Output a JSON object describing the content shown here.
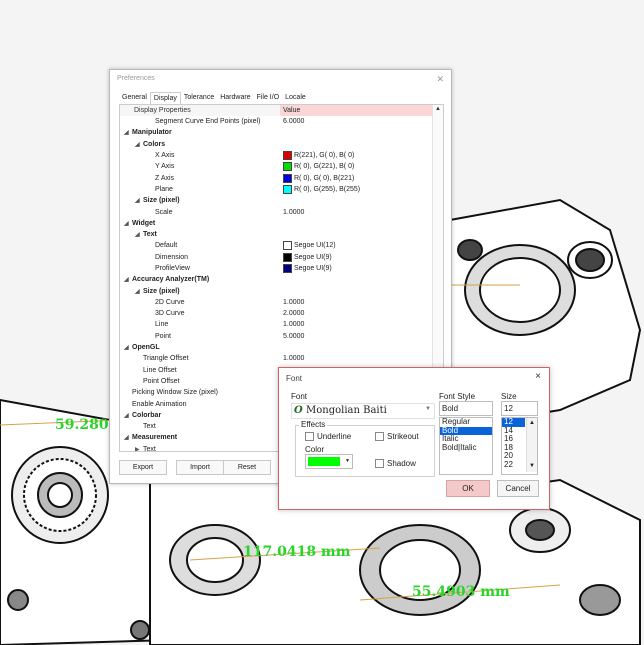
{
  "measurements": [
    "59.280",
    "117.0418 mm",
    "55.4903 mm"
  ],
  "preferences": {
    "title": "Preferences",
    "tabs": [
      "General",
      "Display",
      "Tolerance",
      "Hardware",
      "File I/O",
      "Locale"
    ],
    "active_tab": "Display",
    "header": {
      "property": "Display Properties",
      "value": "Value"
    },
    "rows": [
      {
        "label": "Segment Curve End Points (pixel)",
        "value": "6.0000",
        "level": 3,
        "bold": false
      },
      {
        "label": "Manipulator",
        "value": "",
        "level": 1,
        "bold": true
      },
      {
        "label": "Colors",
        "value": "",
        "level": 2,
        "bold": true
      },
      {
        "label": "X Axis",
        "value": "R(221), G(  0), B(  0)",
        "level": 3,
        "bold": false,
        "swatch": "#dd0000"
      },
      {
        "label": "Y Axis",
        "value": "R(  0), G(221), B(  0)",
        "level": 3,
        "bold": false,
        "swatch": "#00dd00"
      },
      {
        "label": "Z Axis",
        "value": "R(  0), G(  0), B(221)",
        "level": 3,
        "bold": false,
        "swatch": "#0000dd"
      },
      {
        "label": "Plane",
        "value": "R(  0), G(255), B(255)",
        "level": 3,
        "bold": false,
        "swatch": "#00ffff"
      },
      {
        "label": "Size (pixel)",
        "value": "",
        "level": 2,
        "bold": true
      },
      {
        "label": "Scale",
        "value": "1.0000",
        "level": 3,
        "bold": false
      },
      {
        "label": "Widget",
        "value": "",
        "level": 1,
        "bold": true
      },
      {
        "label": "Text",
        "value": "",
        "level": 2,
        "bold": true
      },
      {
        "label": "Default",
        "value": "Segoe UI(12)",
        "level": 3,
        "bold": false,
        "swatch": "#ffffff"
      },
      {
        "label": "Dimension",
        "value": "Segoe UI(9)",
        "level": 3,
        "bold": false,
        "swatch": "#000000"
      },
      {
        "label": "ProfileView",
        "value": "Segoe UI(9)",
        "level": 3,
        "bold": false,
        "swatch": "#000080"
      },
      {
        "label": "Accuracy Analyzer(TM)",
        "value": "",
        "level": 1,
        "bold": true
      },
      {
        "label": "Size (pixel)",
        "value": "",
        "level": 2,
        "bold": true
      },
      {
        "label": "2D Curve",
        "value": "1.0000",
        "level": 3,
        "bold": false
      },
      {
        "label": "3D Curve",
        "value": "2.0000",
        "level": 3,
        "bold": false
      },
      {
        "label": "Line",
        "value": "1.0000",
        "level": 3,
        "bold": false
      },
      {
        "label": "Point",
        "value": "5.0000",
        "level": 3,
        "bold": false
      },
      {
        "label": "OpenGL",
        "value": "",
        "level": 1,
        "bold": true
      },
      {
        "label": "Triangle Offset",
        "value": "1.0000",
        "level": 2,
        "bold": false
      },
      {
        "label": "Line Offset",
        "value": "",
        "level": 2,
        "bold": false
      },
      {
        "label": "Point Offset",
        "value": "",
        "level": 2,
        "bold": false
      },
      {
        "label": "Picking Window Size (pixel)",
        "value": "",
        "level": 1,
        "bold": false
      },
      {
        "label": "Enable Animation",
        "value": "",
        "level": 1,
        "bold": false
      },
      {
        "label": "Colorbar",
        "value": "",
        "level": 1,
        "bold": true
      },
      {
        "label": "Text",
        "value": "",
        "level": 2,
        "bold": false
      },
      {
        "label": "Measurement",
        "value": "",
        "level": 1,
        "bold": true
      },
      {
        "label": "Text",
        "value": "",
        "level": 2,
        "bold": false,
        "collapsed": true
      }
    ],
    "buttons": {
      "export": "Export",
      "import": "Import",
      "reset": "Reset"
    }
  },
  "font_dialog": {
    "title": "Font",
    "close": "×",
    "font_label": "Font",
    "font_value": "Mongolian Baiti",
    "font_glyph": "O",
    "style_label": "Font Style",
    "style_value": "Bold",
    "style_options": [
      "Regular",
      "Bold",
      "Italic",
      "Bold|Italic"
    ],
    "style_selected": 1,
    "size_label": "Size",
    "size_value": "12",
    "size_options": [
      "12",
      "14",
      "16",
      "18",
      "20",
      "22"
    ],
    "size_selected": 0,
    "effects_label": "Effects",
    "underline": "Underline",
    "strikeout": "Strikeout",
    "shadow": "Shadow",
    "color_label": "Color",
    "color": "#00ff00",
    "ok": "OK",
    "cancel": "Cancel"
  }
}
